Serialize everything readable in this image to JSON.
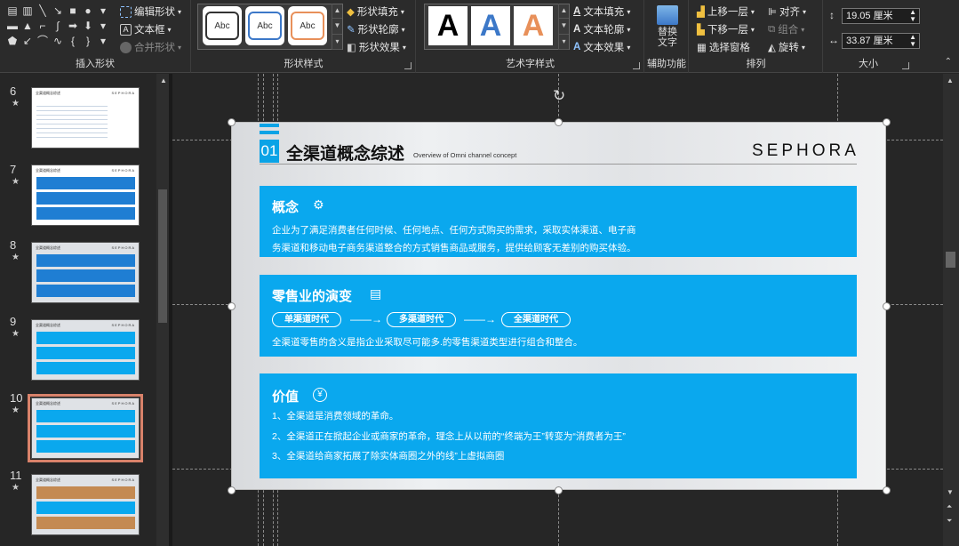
{
  "ribbon": {
    "insert_shapes": {
      "label": "插入形状",
      "edit_shape": "编辑形状",
      "text_box": "文本框",
      "merge_shapes": "合并形状"
    },
    "shape_styles": {
      "label": "形状样式",
      "gallery": [
        "Abc",
        "Abc",
        "Abc"
      ],
      "fill": "形状填充",
      "outline": "形状轮廓",
      "effects": "形状效果"
    },
    "wordart": {
      "label": "艺术字样式",
      "gallery": [
        "A",
        "A",
        "A"
      ],
      "text_fill": "文本填充",
      "text_outline": "文本轮廓",
      "text_effects": "文本效果"
    },
    "accessibility": {
      "label": "辅助功能",
      "alt_text": "替换\n文字"
    },
    "arrange": {
      "label": "排列",
      "bring_forward": "上移一层",
      "send_backward": "下移一层",
      "selection_pane": "选择窗格",
      "align": "对齐",
      "group": "组合",
      "rotate": "旋转"
    },
    "size": {
      "label": "大小",
      "height": "19.05 厘米",
      "width": "33.87 厘米"
    }
  },
  "thumbnails": [
    {
      "num": "6",
      "star": "★"
    },
    {
      "num": "7",
      "star": "★"
    },
    {
      "num": "8",
      "star": "★"
    },
    {
      "num": "9",
      "star": "★"
    },
    {
      "num": "10",
      "star": "★"
    },
    {
      "num": "11",
      "star": "★"
    }
  ],
  "thumb_text": {
    "title": "全渠道概念综述",
    "logo": "SEPHORA"
  },
  "slide": {
    "number": "01",
    "title": "全渠道概念综述",
    "subtitle": "Overview of Omni channel concept",
    "logo": "SEPHORA",
    "concept": {
      "title": "概念",
      "icon": "⚙",
      "line1": "企业为了满足消费者任何时候、任何地点、任何方式购买的需求，采取实体渠道、电子商",
      "line2": "务渠道和移动电子商务渠道整合的方式销售商品或服务，提供给顾客无差别的购买体验。"
    },
    "evolution": {
      "title": "零售业的演变",
      "icon": "▤",
      "stages": [
        "单渠道时代",
        "多渠道时代",
        "全渠道时代"
      ],
      "arrow": "——→",
      "text": "全渠道零售的含义是指企业采取尽可能多.的零售渠道类型进行组合和整合。"
    },
    "value": {
      "title": "价值",
      "icon": "¥",
      "items": [
        "1、全渠道是消费领域的革命。",
        "2、全渠道正在掀起企业或商家的革命，理念上从以前的“终端为王”转变为“消费者为王”",
        "3、全渠道给商家拓展了除实体商圈之外的线”上虚拟商圈"
      ]
    }
  },
  "colors": {
    "accent": "#0aa8ee",
    "selected_thumb": "#d9826a",
    "wordart_blue": "#3c78c8",
    "wordart_orange": "#e8905a"
  }
}
